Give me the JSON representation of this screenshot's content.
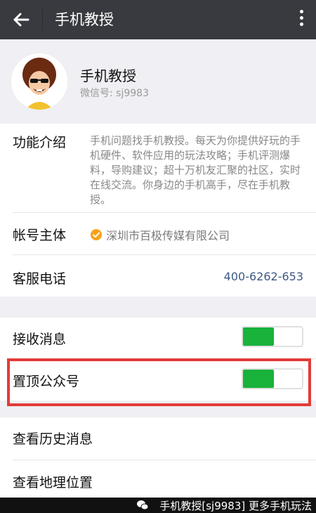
{
  "appbar": {
    "title": "手机教授"
  },
  "profile": {
    "name": "手机教授",
    "wechat_id": "微信号: sj9983"
  },
  "info": {
    "intro_label": "功能介绍",
    "intro_text": "手机问题找手机教授。每天为你提供好玩的手机硬件、软件应用的玩法攻略；手机评测爆料，导购建议；超十万机友汇聚的社区，实时在线交流。你身边的手机高手，尽在手机教授。",
    "owner_label": "帐号主体",
    "owner_value": "深圳市百极传媒有限公司",
    "phone_label": "客服电话",
    "phone_value": "400-6262-653"
  },
  "settings": {
    "receive_label": "接收消息",
    "receive_on": true,
    "pin_label": "置顶公众号",
    "pin_on": true
  },
  "actions": {
    "history_label": "查看历史消息",
    "location_label": "查看地理位置"
  },
  "watermark": "手机教授[sj9983] 更多手机玩法",
  "colors": {
    "appbar": "#393a3f",
    "toggle_on": "#19b23b",
    "highlight": "#e43a3a",
    "phone": "#3e5a85"
  }
}
